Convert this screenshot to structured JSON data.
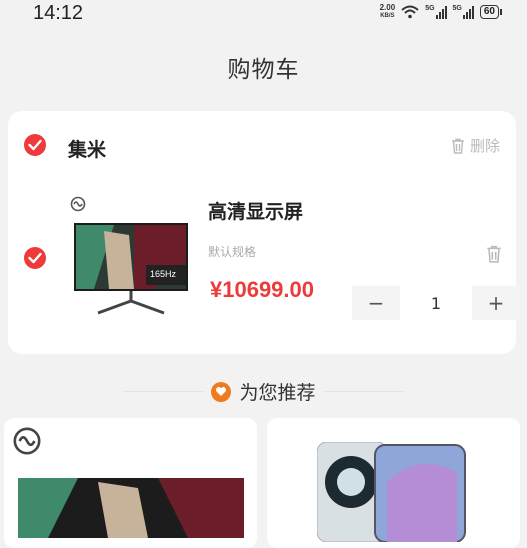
{
  "status_bar": {
    "time": "14:12",
    "net_speed_value": "2.00",
    "net_speed_unit": "KB/S",
    "signal_1_label": "5G",
    "signal_2_label": "5G",
    "battery": "60"
  },
  "page": {
    "title": "购物车"
  },
  "cart": {
    "shop_name": "集米",
    "delete_label": "删除",
    "item": {
      "name": "高清显示屏",
      "spec": "默认规格",
      "price": "¥10699.00",
      "quantity": "1",
      "monitor_badge": "165Hz"
    },
    "stepper": {
      "minus": "−",
      "plus": "+"
    }
  },
  "recommend": {
    "title": "为您推荐"
  },
  "colors": {
    "accent": "#ee3a3a",
    "recommend_icon": "#f07a1e"
  },
  "icons": [
    "check-icon",
    "trash-icon",
    "brand-logo-icon",
    "heart-icon"
  ]
}
